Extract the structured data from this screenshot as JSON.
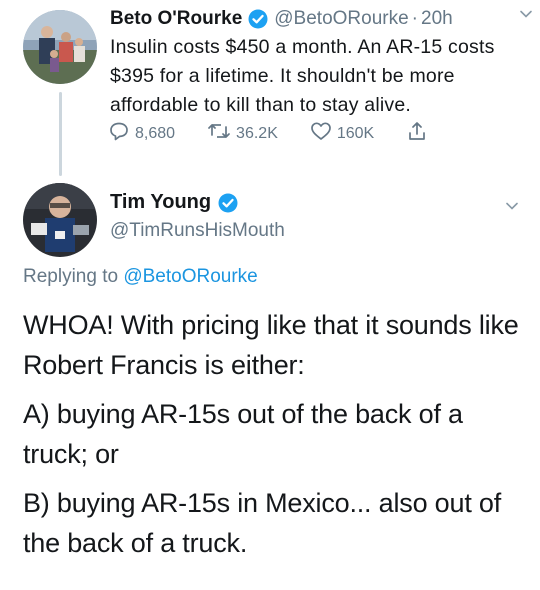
{
  "tweet1": {
    "name": "Beto O'Rourke",
    "handle": "@BetoORourke",
    "separator": "·",
    "time": "20h",
    "text": "Insulin costs $450 a month. An AR-15 costs $395 for a lifetime. It shouldn't be more affordable to kill than to stay alive.",
    "replies": "8,680",
    "retweets": "36.2K",
    "likes": "160K"
  },
  "tweet2": {
    "name": "Tim Young",
    "handle": "@TimRunsHisMouth",
    "replying_prefix": "Replying to",
    "replying_to": "@BetoORourke",
    "paragraphs": [
      "WHOA! With pricing like that it sounds like Robert Francis is either:",
      "A) buying AR-15s out of the back of a truck; or",
      "B) buying AR-15s in Mexico... also out of the back of a truck."
    ]
  },
  "colors": {
    "verified": "#1da1f2",
    "link": "#1b95e0",
    "muted": "#657786",
    "text": "#14171a"
  },
  "icons": [
    "verified-badge-icon",
    "chevron-down-icon",
    "reply-icon",
    "retweet-icon",
    "like-icon",
    "share-icon"
  ]
}
